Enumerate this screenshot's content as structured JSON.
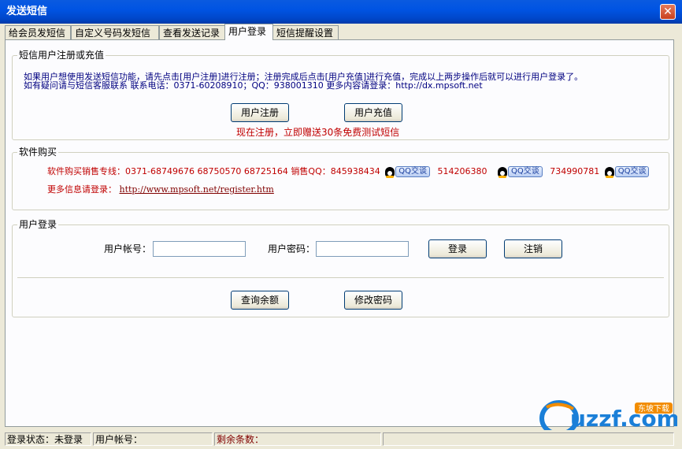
{
  "window": {
    "title": "发送短信",
    "close_glyph": "✕"
  },
  "tabs": [
    {
      "label": "给会员发短信"
    },
    {
      "label": "自定义号码发短信"
    },
    {
      "label": "查看发送记录"
    },
    {
      "label": "用户登录",
      "active": true
    },
    {
      "label": "短信提醒设置"
    }
  ],
  "register": {
    "legend": "短信用户注册或充值",
    "line1": "如果用户想使用发送短信功能，请先点击[用户注册]进行注册；注册完成后点击[用户充值]进行充值，完成以上两步操作后就可以进行用户登录了。",
    "line2": "如有疑问请与短信客服联系  联系电话：0371-60208910；QQ：938001310 更多内容请登录：http://dx.mpsoft.net",
    "register_button": "用户注册",
    "recharge_button": "用户充值",
    "promo": "现在注册，立即赠送30条免费测试短信"
  },
  "purchase": {
    "legend": "软件购买",
    "hotline_label": "软件购买销售专线：0371-68749676 68750570 68725164 销售QQ：845938434",
    "qq2": "514206380",
    "qq3": "734990781",
    "qq_chat_label": "QQ交谈",
    "more_label": "更多信息请登录：",
    "more_link": "http://www.mpsoft.net/register.htm"
  },
  "login": {
    "legend": "用户登录",
    "account_label": "用户帐号：",
    "account_value": "",
    "password_label": "用户密码：",
    "password_value": "",
    "login_button": "登录",
    "logout_button": "注销",
    "balance_button": "查询余额",
    "change_pw_button": "修改密码"
  },
  "status": {
    "login_state": "登录状态：未登录",
    "account": "用户帐号：",
    "remaining": "剩余条数："
  },
  "watermark": {
    "text": "uzzf.com",
    "tag": "东坡下载"
  },
  "colors": {
    "title_bar": "#0054e3",
    "info_blue": "#000080",
    "promo_red": "#c00000",
    "link_maroon": "#800000",
    "face": "#ece9d8"
  }
}
